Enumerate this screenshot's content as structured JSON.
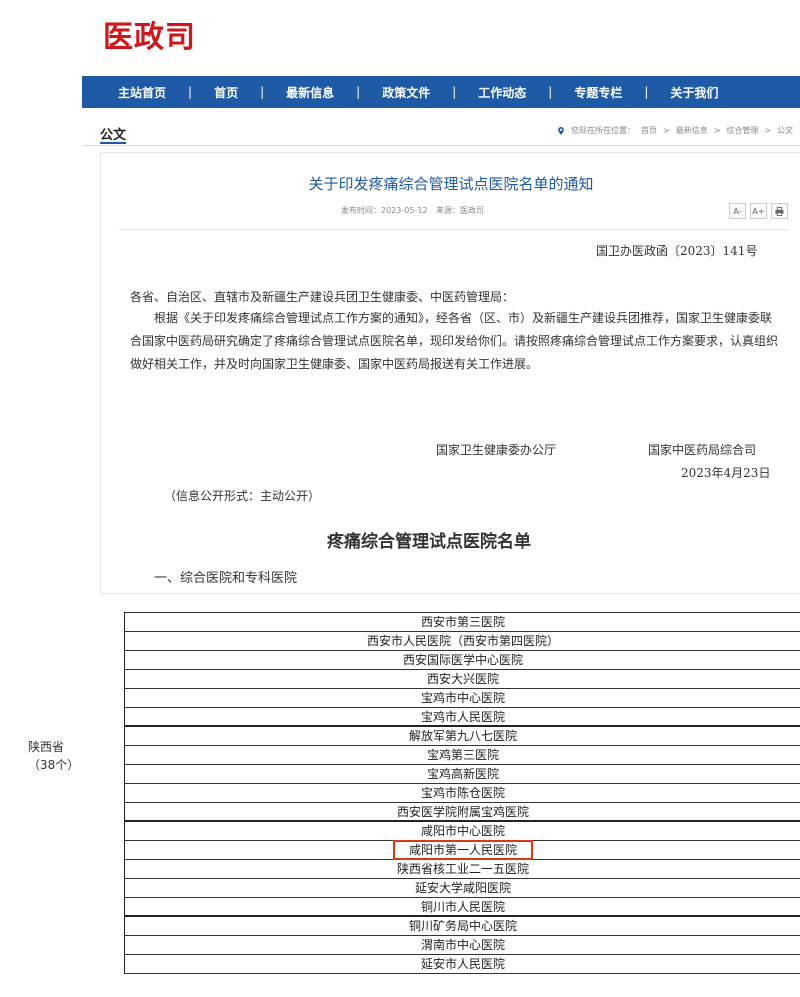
{
  "logo": "医政司",
  "nav": [
    "主站首页",
    "首页",
    "最新信息",
    "政策文件",
    "工作动态",
    "专题专栏",
    "关于我们"
  ],
  "section_title": "公文",
  "breadcrumb": {
    "prefix": "您现在所在位置：",
    "items": [
      "首页",
      "最新信息",
      "综合管理",
      "公文"
    ]
  },
  "doc": {
    "title": "关于印发疼痛综合管理试点医院名单的通知",
    "publish_label": "发布时间：",
    "publish_date": "2023-05-12",
    "source_label": "来源：",
    "source": "医政司",
    "tools": [
      "A-",
      "A+",
      "print-icon"
    ]
  },
  "letter": {
    "doc_number": "国卫办医政函〔2023〕141号",
    "addressee": "各省、自治区、直辖市及新疆生产建设兵团卫生健康委、中医药管理局：",
    "body": "根据《关于印发疼痛综合管理试点工作方案的通知》，经各省（区、市）及新疆生产建设兵团推荐，国家卫生健康委联合国家中医药局研究确定了疼痛综合管理试点医院名单，现印发给你们。请按照疼痛综合管理试点工作方案要求，认真组织做好相关工作，并及时向国家卫生健康委、国家中医药局报送有关工作进展。",
    "sender1": "国家卫生健康委办公厅",
    "sender2": "国家中医药局综合司",
    "date": "2023年4月23日",
    "disclosure": "（信息公开形式：主动公开）"
  },
  "list": {
    "title": "疼痛综合管理试点医院名单",
    "subheading": "一、综合医院和专科医院",
    "province_name": "陕西省",
    "province_count": "（38个）",
    "hospitals": [
      "西安市第三医院",
      "西安市人民医院（西安市第四医院）",
      "西安国际医学中心医院",
      "西安大兴医院",
      "宝鸡市中心医院",
      "宝鸡市人民医院",
      "解放军第九八七医院",
      "宝鸡第三医院",
      "宝鸡高新医院",
      "宝鸡市陈仓医院",
      "西安医学院附属宝鸡医院",
      "咸阳市中心医院",
      "咸阳市第一人民医院",
      "陕西省核工业二一五医院",
      "延安大学咸阳医院",
      "铜川市人民医院",
      "铜川矿务局中心医院",
      "渭南市中心医院",
      "延安市人民医院"
    ],
    "highlighted": "咸阳市第一人民医院",
    "highlight_color": "#d73a17"
  },
  "colors": {
    "brand_red": "#d2141b",
    "nav_blue": "#1f5aa6"
  }
}
